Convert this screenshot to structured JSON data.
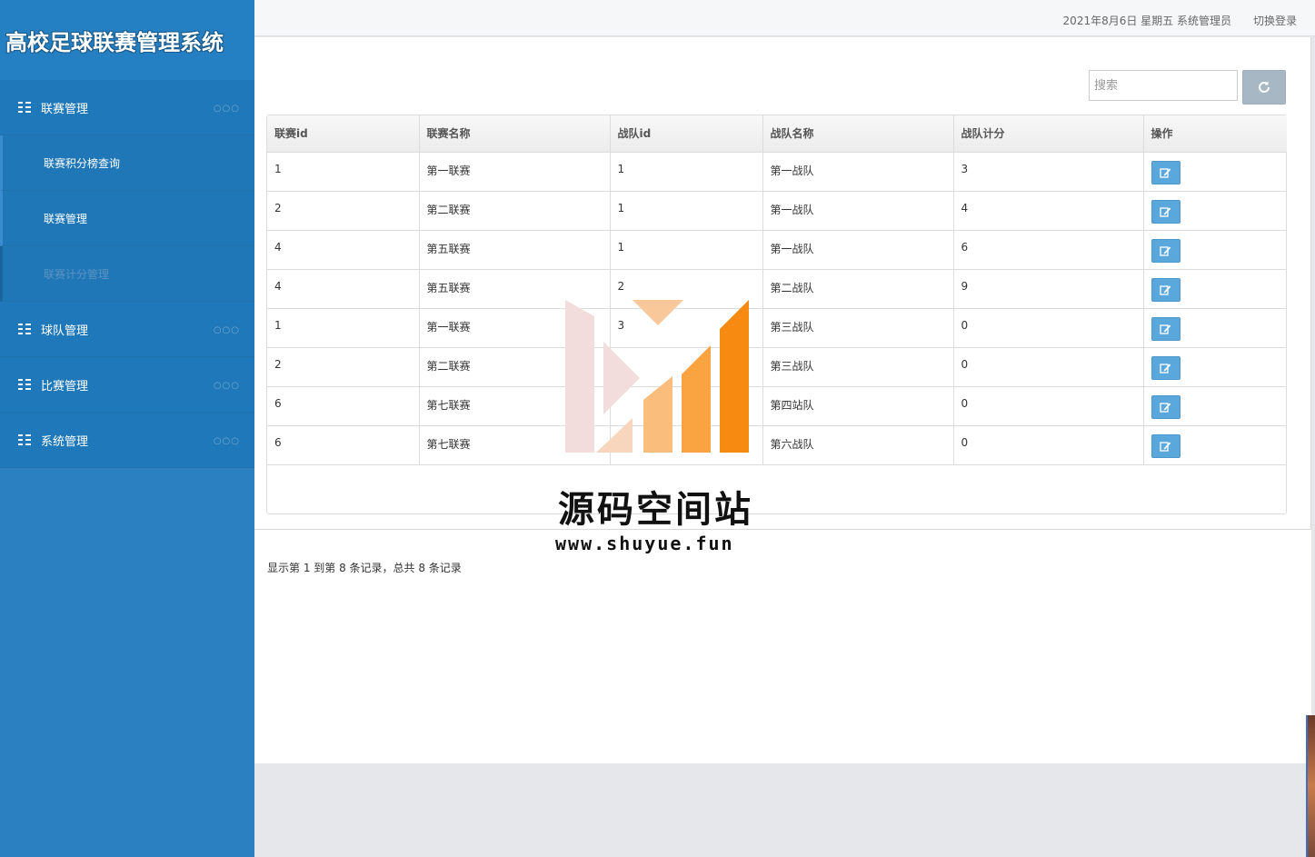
{
  "app": {
    "title": "高校足球联赛管理系统"
  },
  "sidebar": {
    "groups": [
      {
        "label": "联赛管理",
        "dots": "○○○"
      },
      {
        "label": "球队管理",
        "dots": "○○○"
      },
      {
        "label": "比赛管理",
        "dots": "○○○"
      },
      {
        "label": "系统管理",
        "dots": "○○○"
      }
    ],
    "sub_items": [
      {
        "label": "联赛积分榜查询"
      },
      {
        "label": "联赛管理"
      },
      {
        "label": "联赛计分管理"
      }
    ]
  },
  "topbar": {
    "date_user": "2021年8月6日 星期五 系统管理员",
    "logout": "切换登录"
  },
  "search": {
    "placeholder": "搜索"
  },
  "table": {
    "headers": [
      "联赛id",
      "联赛名称",
      "战队id",
      "战队名称",
      "战队计分",
      "操作"
    ],
    "rows": [
      [
        "1",
        "第一联赛",
        "1",
        "第一战队",
        "3"
      ],
      [
        "2",
        "第二联赛",
        "1",
        "第一战队",
        "4"
      ],
      [
        "4",
        "第五联赛",
        "1",
        "第一战队",
        "6"
      ],
      [
        "4",
        "第五联赛",
        "2",
        "第二战队",
        "9"
      ],
      [
        "1",
        "第一联赛",
        "3",
        "第三战队",
        "0"
      ],
      [
        "2",
        "第二联赛",
        "",
        "第三战队",
        "0"
      ],
      [
        "6",
        "第七联赛",
        "",
        "第四站队",
        "0"
      ],
      [
        "6",
        "第七联赛",
        "",
        "第六战队",
        "0"
      ]
    ]
  },
  "pagination": {
    "summary": "显示第 1 到第 8 条记录，总共 8 条记录"
  },
  "watermark": {
    "title": "源码空间站",
    "url": "www.shuyue.fun"
  },
  "colors": {
    "sidebar": "#2a80c1",
    "edit_button": "#5aa7db",
    "refresh_button": "#a8b7c4"
  }
}
